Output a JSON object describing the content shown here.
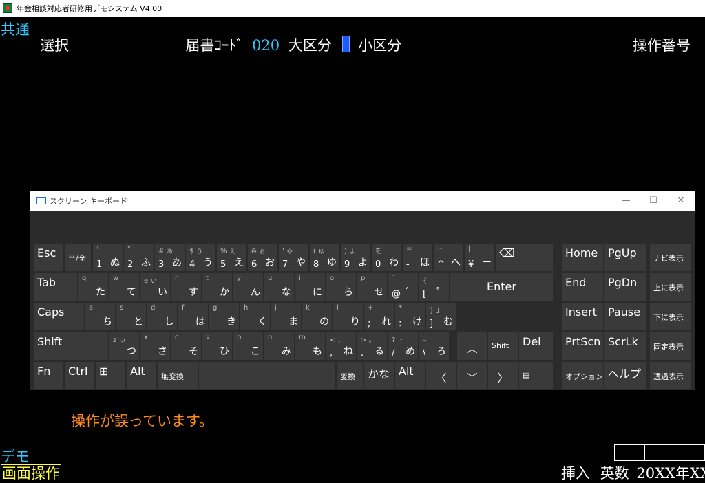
{
  "window": {
    "title": "年金相談対応者研修用デモシステム V4.00"
  },
  "header": {
    "section": "共通",
    "select_label": "選択",
    "form_code_label": "届書ｺｰﾄﾞ",
    "form_code_value": "020",
    "major_label": "大区分",
    "minor_label": "小区分",
    "op_number_label": "操作番号"
  },
  "message": {
    "error": "操作が誤っています。"
  },
  "footer": {
    "demo_label": "デモ",
    "screen_op_label": "画面操作",
    "status_left": "挿入",
    "status_mode": "英数",
    "status_date": "20XX年XX"
  },
  "keyboard": {
    "title": "スクリーン キーボード",
    "min_icon": "—",
    "max_icon": "☐",
    "close_icon": "✕",
    "keys": [
      {
        "id": "esc",
        "main": "Esc"
      },
      {
        "id": "hankaku",
        "main": "半/全",
        "small": true
      },
      {
        "id": "k1",
        "sh": "!",
        "ch": "1",
        "kn": "ぬ"
      },
      {
        "id": "k2",
        "sh": "\"",
        "ch": "2",
        "kn": "ふ"
      },
      {
        "id": "k3",
        "sh": "#  ぁ",
        "ch": "3",
        "kn": "あ"
      },
      {
        "id": "k4",
        "sh": "$  ぅ",
        "ch": "4",
        "kn": "う"
      },
      {
        "id": "k5",
        "sh": "%  ぇ",
        "ch": "5",
        "kn": "え"
      },
      {
        "id": "k6",
        "sh": "&  ぉ",
        "ch": "6",
        "kn": "お"
      },
      {
        "id": "k7",
        "sh": "'  ゃ",
        "ch": "7",
        "kn": "や"
      },
      {
        "id": "k8",
        "sh": "(  ゅ",
        "ch": "8",
        "kn": "ゆ"
      },
      {
        "id": "k9",
        "sh": ")  ょ",
        "ch": "9",
        "kn": "よ"
      },
      {
        "id": "k0",
        "sh": "    を",
        "ch": "0",
        "kn": "わ"
      },
      {
        "id": "kminus",
        "sh": "=",
        "ch": "-",
        "kn": "ほ"
      },
      {
        "id": "kcaret",
        "sh": "~",
        "ch": "^",
        "kn": "へ"
      },
      {
        "id": "kyen",
        "sh": "|",
        "ch": "¥",
        "kn": "ー"
      },
      {
        "id": "bksp",
        "main": "⌫"
      },
      {
        "id": "home",
        "main": "Home"
      },
      {
        "id": "pgup",
        "main": "PgUp"
      },
      {
        "id": "navi",
        "main": "ナビ表示",
        "small": true
      },
      {
        "id": "tab",
        "main": "Tab"
      },
      {
        "id": "q",
        "sh": "q",
        "kn": "た"
      },
      {
        "id": "w",
        "sh": "w",
        "kn": "て"
      },
      {
        "id": "e",
        "sh": "e  ぃ",
        "kn": "い"
      },
      {
        "id": "r",
        "sh": "r",
        "kn": "す"
      },
      {
        "id": "t",
        "sh": "t",
        "kn": "か"
      },
      {
        "id": "y",
        "sh": "y",
        "kn": "ん"
      },
      {
        "id": "u",
        "sh": "u",
        "kn": "な"
      },
      {
        "id": "i",
        "sh": "i",
        "kn": "に"
      },
      {
        "id": "o",
        "sh": "o",
        "kn": "ら"
      },
      {
        "id": "p",
        "sh": "p",
        "kn": "せ"
      },
      {
        "id": "at",
        "sh": "`",
        "lo": "@",
        "kn": "゛"
      },
      {
        "id": "lbr",
        "sh": "{  「",
        "lo": "[",
        "kn": "゜"
      },
      {
        "id": "enter",
        "main": "Enter"
      },
      {
        "id": "end",
        "main": "End"
      },
      {
        "id": "pgdn",
        "main": "PgDn"
      },
      {
        "id": "up_disp",
        "main": "上に表示",
        "small": true
      },
      {
        "id": "caps",
        "main": "Caps"
      },
      {
        "id": "a",
        "sh": "a",
        "kn": "ち"
      },
      {
        "id": "s",
        "sh": "s",
        "kn": "と"
      },
      {
        "id": "d",
        "sh": "d",
        "kn": "し"
      },
      {
        "id": "f",
        "sh": "f",
        "kn": "は"
      },
      {
        "id": "g",
        "sh": "g",
        "kn": "き"
      },
      {
        "id": "h",
        "sh": "h",
        "kn": "く"
      },
      {
        "id": "j",
        "sh": "j",
        "kn": "ま"
      },
      {
        "id": "k",
        "sh": "k",
        "kn": "の"
      },
      {
        "id": "l",
        "sh": "l",
        "kn": "り"
      },
      {
        "id": "semi",
        "sh": "+",
        "lo": ";",
        "kn": "れ"
      },
      {
        "id": "colon",
        "sh": "*",
        "lo": ":",
        "kn": "け"
      },
      {
        "id": "rbr",
        "sh": "}  」",
        "lo": "]",
        "kn": "む"
      },
      {
        "id": "insert",
        "main": "Insert"
      },
      {
        "id": "pause",
        "main": "Pause"
      },
      {
        "id": "down_disp",
        "main": "下に表示",
        "small": true
      },
      {
        "id": "shift",
        "main": "Shift"
      },
      {
        "id": "z",
        "sh": "z  っ",
        "kn": "つ"
      },
      {
        "id": "x",
        "sh": "x",
        "kn": "さ"
      },
      {
        "id": "c",
        "sh": "c",
        "kn": "そ"
      },
      {
        "id": "v",
        "sh": "v",
        "kn": "ひ"
      },
      {
        "id": "b",
        "sh": "b",
        "kn": "こ"
      },
      {
        "id": "n",
        "sh": "n",
        "kn": "み"
      },
      {
        "id": "m",
        "sh": "m",
        "kn": "も"
      },
      {
        "id": "comma",
        "sh": "<  、",
        "lo": ",",
        "kn": "ね"
      },
      {
        "id": "period",
        "sh": ">  。",
        "lo": ".",
        "kn": "る"
      },
      {
        "id": "slash",
        "sh": "?  ・",
        "lo": "/",
        "kn": "め"
      },
      {
        "id": "bslash",
        "sh": "_",
        "lo": "\\",
        "kn": "ろ"
      },
      {
        "id": "uparrow",
        "main": "︿"
      },
      {
        "id": "rshift",
        "main": "Shift",
        "small": true
      },
      {
        "id": "del",
        "main": "Del"
      },
      {
        "id": "prtscn",
        "main": "PrtScn"
      },
      {
        "id": "scrlk",
        "main": "ScrLk"
      },
      {
        "id": "fixed",
        "main": "固定表示",
        "small": true
      },
      {
        "id": "fn",
        "main": "Fn"
      },
      {
        "id": "ctrl",
        "main": "Ctrl"
      },
      {
        "id": "win",
        "main": "⊞"
      },
      {
        "id": "alt",
        "main": "Alt"
      },
      {
        "id": "muhenkan",
        "main": "無変換",
        "small": true
      },
      {
        "id": "space",
        "main": ""
      },
      {
        "id": "henkan",
        "main": "変換",
        "small": true
      },
      {
        "id": "kana",
        "main": "かな"
      },
      {
        "id": "ralt",
        "main": "Alt"
      },
      {
        "id": "left",
        "main": "〈"
      },
      {
        "id": "down",
        "main": "﹀"
      },
      {
        "id": "right",
        "main": "〉"
      },
      {
        "id": "menu",
        "main": "▤",
        "small": true
      },
      {
        "id": "options",
        "main": "オプション",
        "small": true
      },
      {
        "id": "help",
        "main": "ヘルプ"
      },
      {
        "id": "transparent",
        "main": "透過表示",
        "small": true
      }
    ]
  }
}
